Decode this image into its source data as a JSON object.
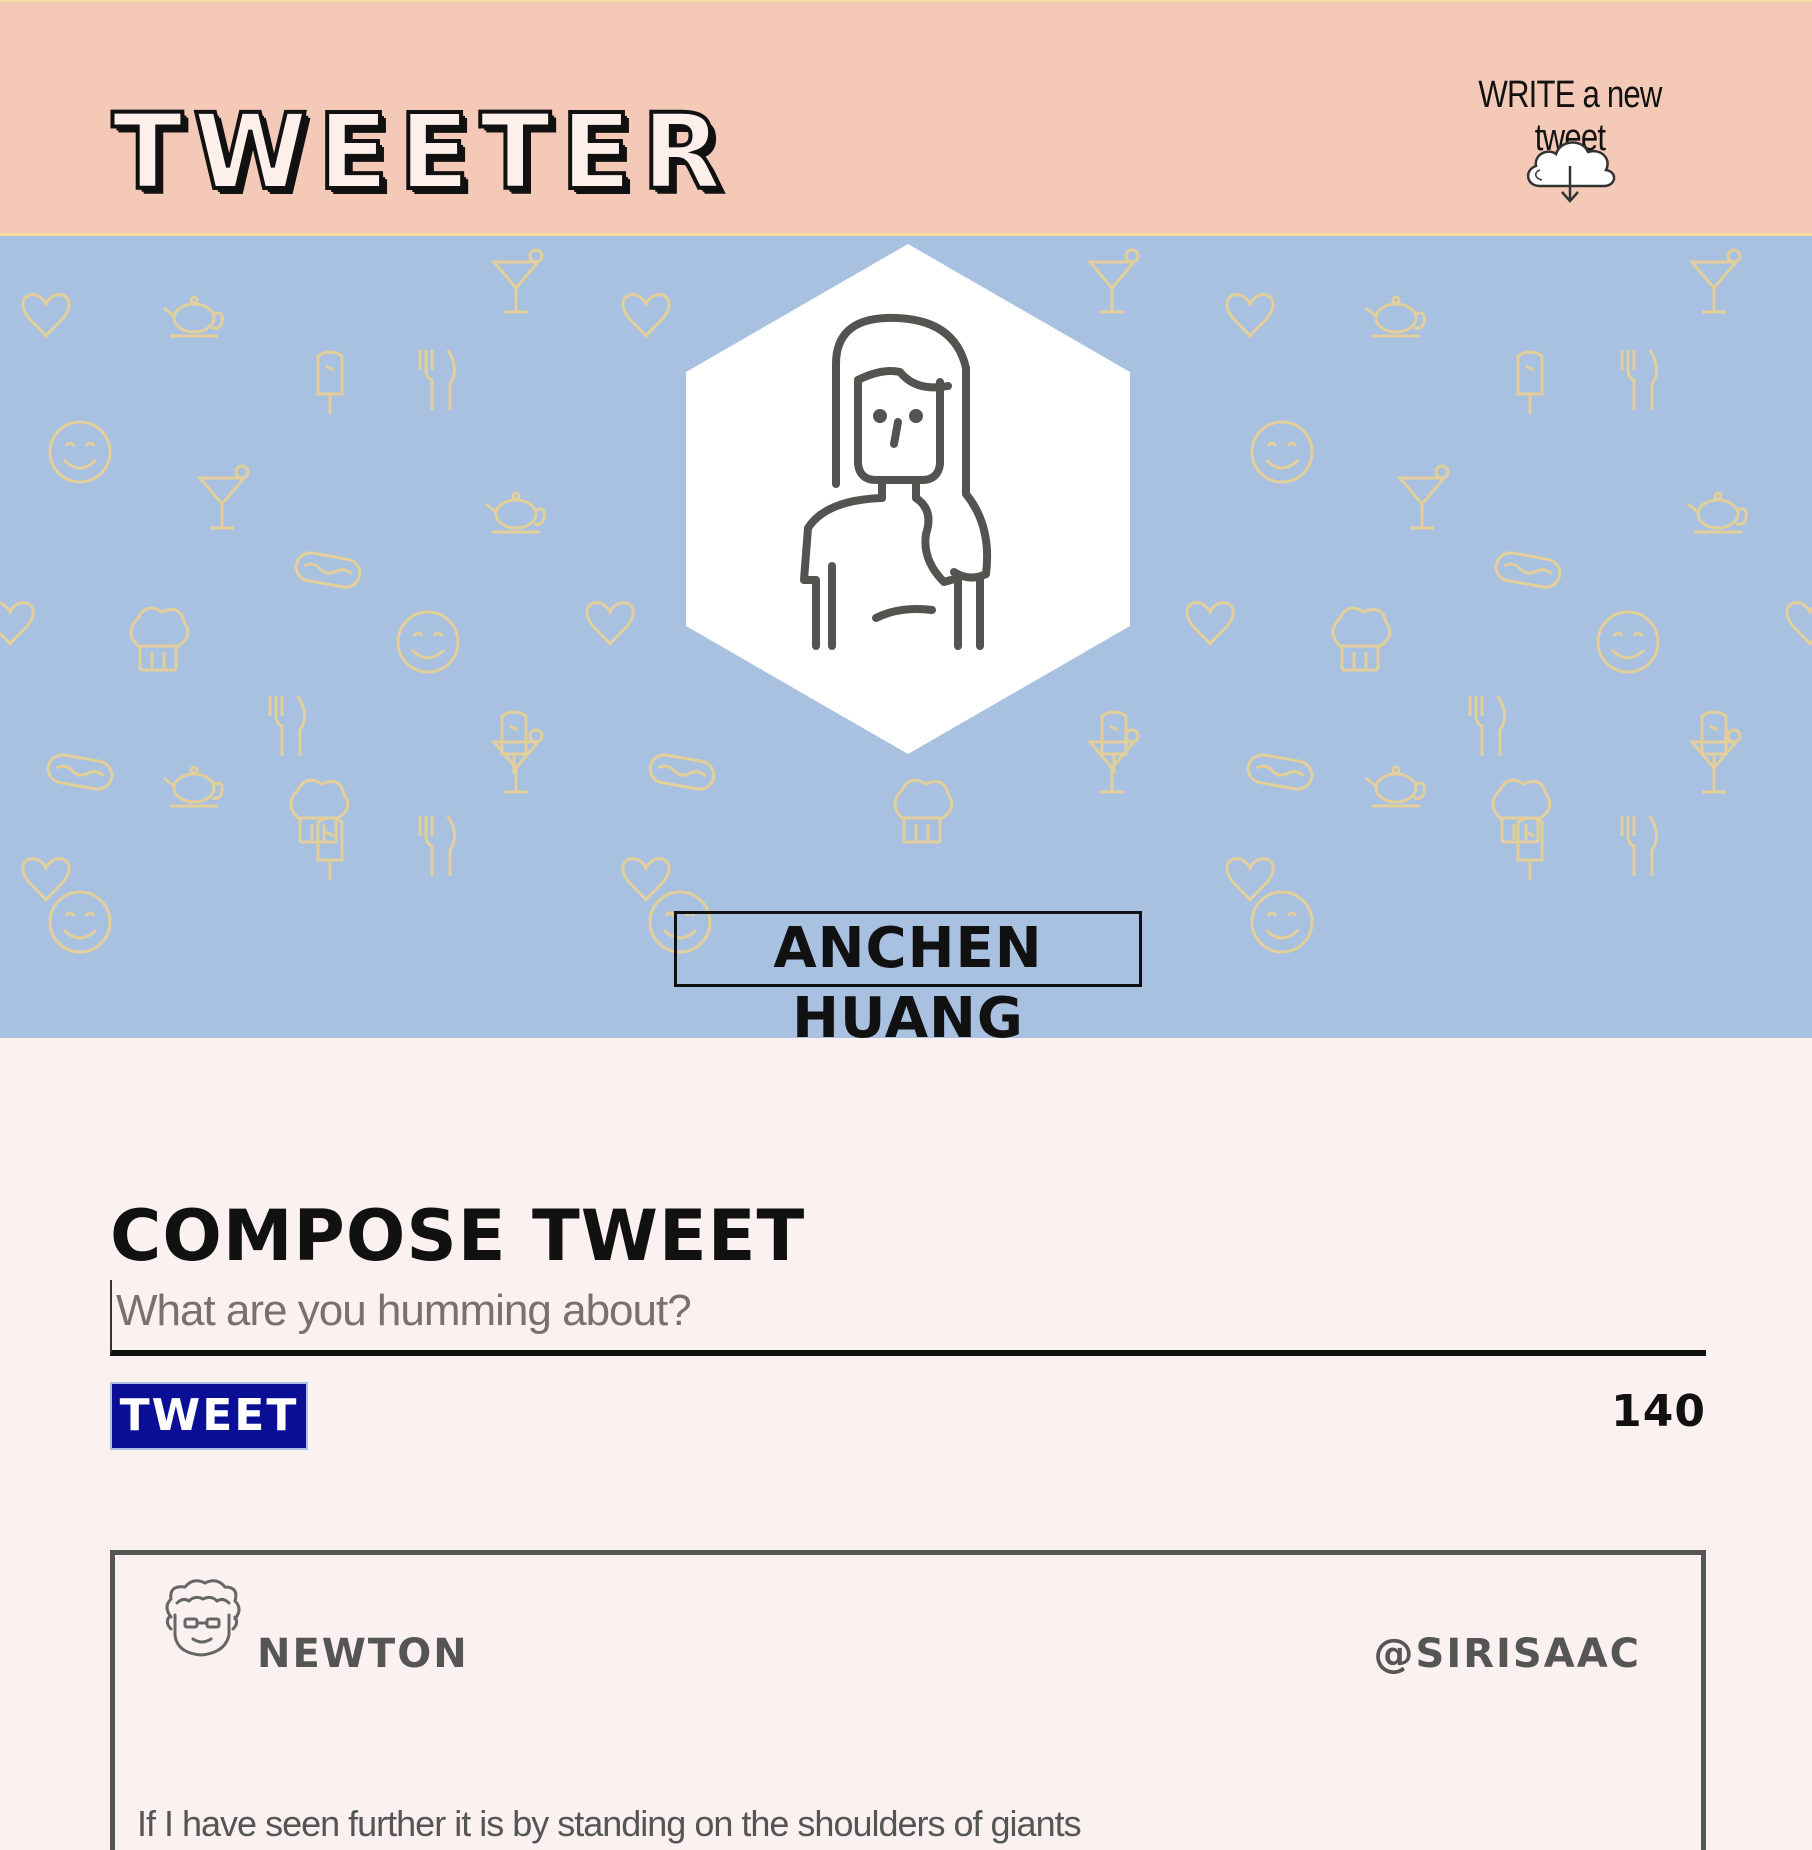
{
  "nav": {
    "brand": "TWEETER",
    "compose_toggle_label": "WRITE a new tweet",
    "compose_toggle_icon": "cloud-download-icon"
  },
  "profile": {
    "name": "ANCHEN HUANG",
    "avatar_icon": "woman-avatar-icon",
    "background_color": "#a8c1e0",
    "pattern_color": "#e3cf9a"
  },
  "compose": {
    "title": "COMPOSE TWEET",
    "placeholder": "What are you humming about?",
    "value": "",
    "submit_label": "TWEET",
    "counter": "140",
    "submit_color": "#0a0f96"
  },
  "tweets": [
    {
      "avatar_icon": "curly-hair-avatar-icon",
      "name": "NEWTON",
      "handle": "@SIRISAAC",
      "content": "If I have seen further it is by standing on the shoulders of giants"
    }
  ],
  "colors": {
    "nav_bg": "#f5c9b7",
    "page_bg": "#fbf1f0",
    "accent_border": "#f7dc9d"
  }
}
